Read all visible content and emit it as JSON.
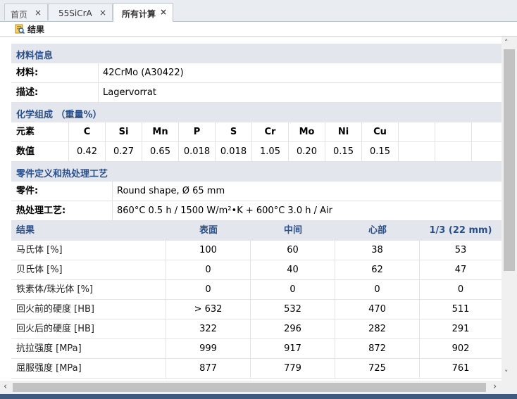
{
  "tabs": [
    {
      "label": "首页",
      "close": "×"
    },
    {
      "label": "55SiCrA",
      "close": "×"
    },
    {
      "label": "所有计算",
      "close": "×"
    }
  ],
  "toolbar": {
    "result_label": "结果",
    "icon": "result-icon"
  },
  "material_section": {
    "title": "材料信息",
    "material_label": "材料:",
    "material_value": "42CrMo (A30422)",
    "description_label": "描述:",
    "description_value": "Lagervorrat"
  },
  "composition_section": {
    "title": "化学组成 （重量%）",
    "element_label": "元素",
    "value_label": "数值",
    "elements": [
      "C",
      "Si",
      "Mn",
      "P",
      "S",
      "Cr",
      "Mo",
      "Ni",
      "Cu"
    ],
    "values": [
      "0.42",
      "0.27",
      "0.65",
      "0.018",
      "0.018",
      "1.05",
      "0.20",
      "0.15",
      "0.15"
    ]
  },
  "part_section": {
    "title": "零件定义和热处理工艺",
    "part_label": "零件:",
    "part_value": "Round shape, Ø 65 mm",
    "process_label": "热处理工艺:",
    "process_value": "860°C 0.5 h / 1500 W/m²•K + 600°C 3.0 h / Air"
  },
  "results_section": {
    "title": "结果",
    "columns": [
      "表面",
      "中间",
      "心部",
      "1/3 (22 mm)"
    ],
    "rows": [
      {
        "label": "马氏体 [%]",
        "values": [
          "100",
          "60",
          "38",
          "53"
        ]
      },
      {
        "label": "贝氏体 [%]",
        "values": [
          "0",
          "40",
          "62",
          "47"
        ]
      },
      {
        "label": "铁素体/珠光体 [%]",
        "values": [
          "0",
          "0",
          "0",
          "0"
        ]
      },
      {
        "label": "回火前的硬度 [HB]",
        "values": [
          "> 632",
          "532",
          "470",
          "511"
        ]
      },
      {
        "label": "回火后的硬度 [HB]",
        "values": [
          "322",
          "296",
          "282",
          "291"
        ]
      },
      {
        "label": "抗拉强度 [MPa]",
        "values": [
          "999",
          "917",
          "872",
          "902"
        ]
      },
      {
        "label": "屈服强度 [MPa]",
        "values": [
          "877",
          "779",
          "725",
          "761"
        ]
      }
    ]
  },
  "scrollbar": {
    "up": "˄",
    "down": "˅",
    "left": "‹",
    "right": "›"
  },
  "colors": {
    "section_bg": "#e3e7ed",
    "section_text": "#2b4f8a",
    "status_bar": "#3e5a80"
  }
}
